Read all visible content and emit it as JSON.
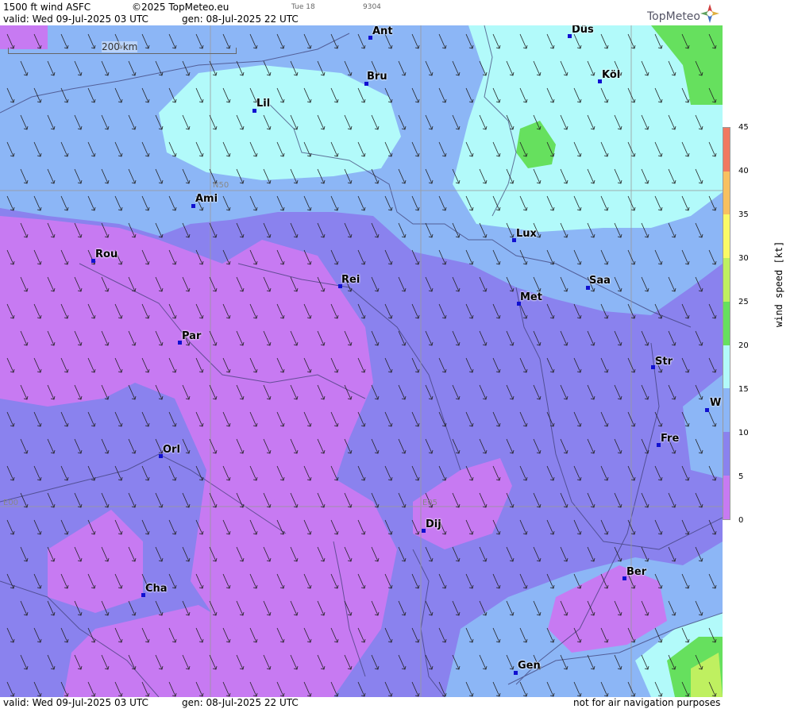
{
  "header": {
    "product": "1500 ft wind ASFC",
    "copyright": "©2025 TopMeteo.eu",
    "day_short": "Tue 18",
    "code": "9304",
    "valid": "valid:  Wed  09-Jul-2025  03 UTC",
    "gen": "gen: 08-Jul-2025 22 UTC"
  },
  "logo": {
    "text": "TopMeteo"
  },
  "scale": {
    "label": "200 km"
  },
  "grid_labels": {
    "n50": "N50",
    "e00": "E00",
    "e05": "E05"
  },
  "cities": [
    {
      "label": "Ant"
    },
    {
      "label": "Düs"
    },
    {
      "label": "Bru"
    },
    {
      "label": "Köl"
    },
    {
      "label": "Lil"
    },
    {
      "label": "Ami"
    },
    {
      "label": "Rou"
    },
    {
      "label": "Lux"
    },
    {
      "label": "Rei"
    },
    {
      "label": "Saa"
    },
    {
      "label": "Met"
    },
    {
      "label": "Par"
    },
    {
      "label": "Str"
    },
    {
      "label": "W"
    },
    {
      "label": "Fre"
    },
    {
      "label": "Orl"
    },
    {
      "label": "Dij"
    },
    {
      "label": "Ber"
    },
    {
      "label": "Cha"
    },
    {
      "label": "Gen"
    }
  ],
  "colorbar": {
    "title": "wind  speed  [kt]",
    "ticks": [
      "45",
      "40",
      "35",
      "30",
      "25",
      "20",
      "15",
      "10",
      "5",
      "0"
    ],
    "colors": {
      "0-5": "#c77af2",
      "5-10": "#8a82ee",
      "10-15": "#8cb6f6",
      "15-20": "#b2fafa",
      "20-25": "#66e05e",
      "25-30": "#bff060",
      "30-35": "#fafa66",
      "35-40": "#f8c060",
      "40-45": "#f07860"
    }
  },
  "footer": {
    "valid": "valid:  Wed  09-Jul-2025  03 UTC",
    "gen": "gen: 08-Jul-2025 22 UTC",
    "note": "not for air navigation purposes"
  }
}
